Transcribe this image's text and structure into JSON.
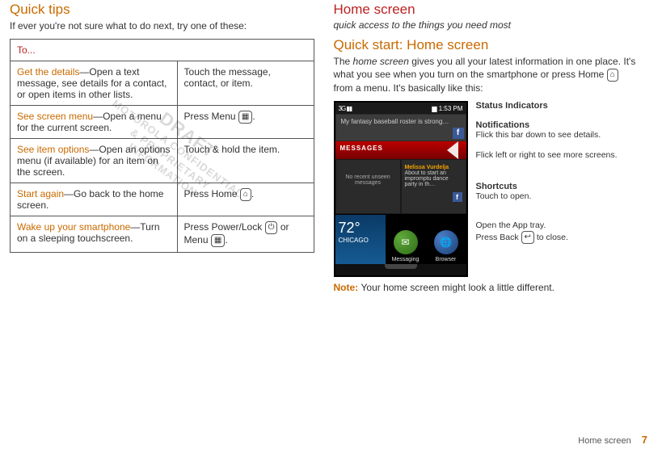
{
  "left": {
    "heading": "Quick tips",
    "intro": "If ever you're not sure what to do next, try one of these:",
    "table_header": "To...",
    "rows": [
      {
        "key_bold": "Get the details",
        "key_rest": "—Open a text message, see details for a contact, or open items in other lists.",
        "val": "Touch the message, contact, or item."
      },
      {
        "key_bold": "See screen menu",
        "key_rest": "—Open a menu for the current screen.",
        "val_pre": "Press Menu ",
        "icon": "menu"
      },
      {
        "key_bold": "See item options",
        "key_rest": "—Open an options menu (if available) for an item on the screen.",
        "val": "Touch & hold the item."
      },
      {
        "key_bold": "Start again",
        "key_rest": "—Go back to the home screen.",
        "val_pre": "Press Home ",
        "icon": "home"
      },
      {
        "key_bold": "Wake up your smartphone",
        "key_rest": "—Turn on a sleeping touchscreen.",
        "val_multi": [
          "Press Power/Lock ",
          "power",
          " or Menu ",
          "menu",
          "."
        ]
      }
    ]
  },
  "right": {
    "heading": "Home screen",
    "subtitle": "quick access to the things you need most",
    "quickstart": "Quick start: Home screen",
    "intro_parts": [
      "The ",
      "home screen",
      " gives you all your latest information in one place. It's what you see when you turn on the smartphone or press Home ",
      " from a menu. It's basically like this:"
    ],
    "note_label": "Note: ",
    "note_text": "Your home screen might look a little different."
  },
  "phone": {
    "signal": "3G ▮▮",
    "battery": "▆",
    "time": "1:53 PM",
    "notif_line": "My fantasy baseball roster is strong…",
    "messages_label": "MESSAGES",
    "msg_pane": "No recent unseen messages",
    "card_name": "Melissa Vurdelja",
    "card_text": "About to start an impromptu dance party in th…",
    "temp": "72°",
    "city": "CHICAGO",
    "icon1": "Messaging",
    "icon2": "Browser"
  },
  "callouts": {
    "status_h": "Status Indicators",
    "notif_h": "Notifications",
    "notif_d": "Flick this bar down to see details.",
    "flick_d": "Flick left or right to see more screens.",
    "short_h": "Shortcuts",
    "short_d": "Touch to open.",
    "tray_d1": "Open the App tray.",
    "tray_d2": "Press Back ",
    "tray_d3": " to close."
  },
  "watermark": {
    "l1": "DRAFT",
    "l2": "MOTOROLA CONFIDENTIAL",
    "l3": "& PROPRIETARY",
    "l4": "INFORMATION"
  },
  "footer": {
    "label": "Home screen",
    "page": "7"
  },
  "icons": {
    "menu": "▦",
    "home": "⌂",
    "power": "⏻",
    "back": "↩"
  }
}
